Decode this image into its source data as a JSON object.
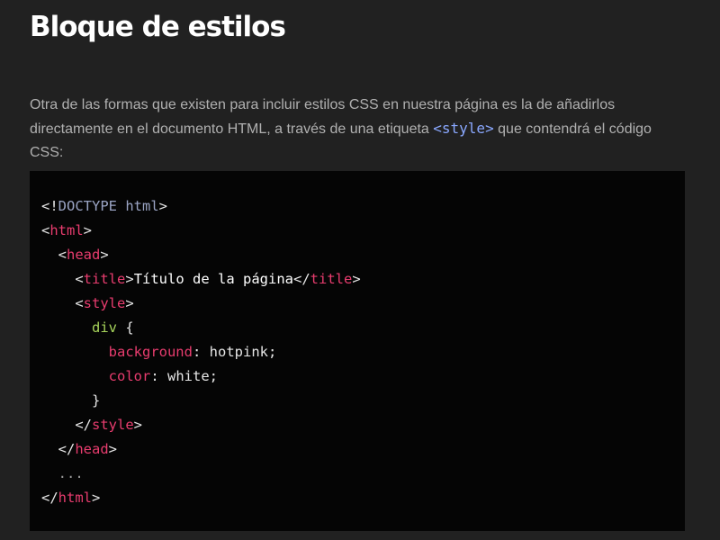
{
  "section": {
    "title": "Bloque de estilos",
    "paragraph_before": "Otra de las formas que existen para incluir estilos CSS en nuestra página es la de añadirlos directamente en el documento HTML, a través de una etiqueta ",
    "inline_code": "<style>",
    "paragraph_after": " que contendrá el código CSS:"
  },
  "code": {
    "lines": [
      [
        {
          "t": "punct",
          "v": "<!"
        },
        {
          "t": "doctype",
          "v": "DOCTYPE html"
        },
        {
          "t": "punct",
          "v": ">"
        }
      ],
      [
        {
          "t": "punct",
          "v": "<"
        },
        {
          "t": "tag",
          "v": "html"
        },
        {
          "t": "punct",
          "v": ">"
        }
      ],
      [
        {
          "t": "punct",
          "v": "  <"
        },
        {
          "t": "tag",
          "v": "head"
        },
        {
          "t": "punct",
          "v": ">"
        }
      ],
      [
        {
          "t": "punct",
          "v": "    <"
        },
        {
          "t": "tag",
          "v": "title"
        },
        {
          "t": "punct",
          "v": ">"
        },
        {
          "t": "text",
          "v": "Título de la página"
        },
        {
          "t": "punct",
          "v": "</"
        },
        {
          "t": "tag",
          "v": "title"
        },
        {
          "t": "punct",
          "v": ">"
        }
      ],
      [
        {
          "t": "punct",
          "v": "    <"
        },
        {
          "t": "tag",
          "v": "style"
        },
        {
          "t": "punct",
          "v": ">"
        }
      ],
      [
        {
          "t": "punct",
          "v": "      "
        },
        {
          "t": "selector",
          "v": "div"
        },
        {
          "t": "punct",
          "v": " {"
        }
      ],
      [
        {
          "t": "punct",
          "v": "        "
        },
        {
          "t": "prop",
          "v": "background"
        },
        {
          "t": "punct",
          "v": ": "
        },
        {
          "t": "value",
          "v": "hotpink"
        },
        {
          "t": "punct",
          "v": ";"
        }
      ],
      [
        {
          "t": "punct",
          "v": "        "
        },
        {
          "t": "prop",
          "v": "color"
        },
        {
          "t": "punct",
          "v": ": "
        },
        {
          "t": "value",
          "v": "white"
        },
        {
          "t": "punct",
          "v": ";"
        }
      ],
      [
        {
          "t": "punct",
          "v": "      }"
        }
      ],
      [
        {
          "t": "punct",
          "v": "    </"
        },
        {
          "t": "tag",
          "v": "style"
        },
        {
          "t": "punct",
          "v": ">"
        }
      ],
      [
        {
          "t": "punct",
          "v": "  </"
        },
        {
          "t": "tag",
          "v": "head"
        },
        {
          "t": "punct",
          "v": ">"
        }
      ],
      [
        {
          "t": "ellipsis",
          "v": "  ..."
        }
      ],
      [
        {
          "t": "punct",
          "v": "</"
        },
        {
          "t": "tag",
          "v": "html"
        },
        {
          "t": "punct",
          "v": ">"
        }
      ]
    ]
  },
  "colors": {
    "background": "#212121",
    "code_background": "#050505",
    "tag": "#e83c6e",
    "selector": "#a6d35a",
    "inline_code": "#8aa8ff"
  }
}
